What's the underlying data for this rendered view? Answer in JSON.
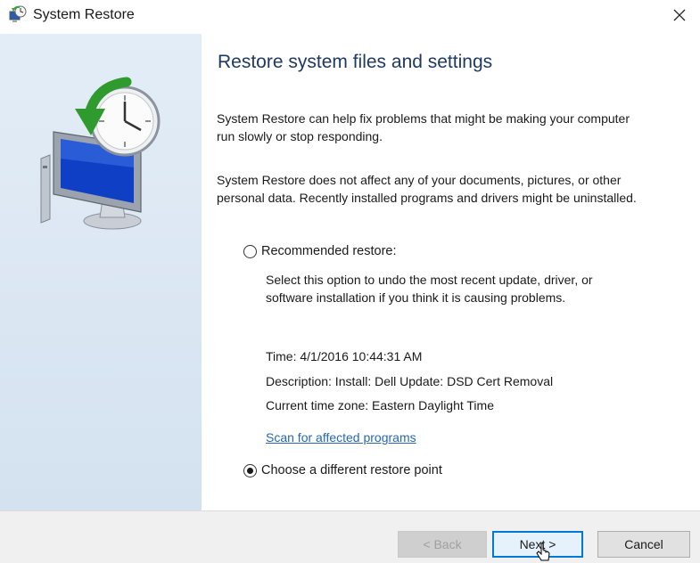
{
  "window": {
    "title": "System Restore",
    "close_icon": "close-icon",
    "app_icon": "system-restore-icon"
  },
  "sidebar": {
    "illustration": "computer-clock-restore-icon"
  },
  "content": {
    "heading": "Restore system files and settings",
    "paragraph1": "System Restore can help fix problems that might be making your computer run slowly or stop responding.",
    "paragraph2": "System Restore does not affect any of your documents, pictures, or other personal data. Recently installed programs and drivers might be uninstalled.",
    "options": {
      "recommended": {
        "label": "Recommended restore:",
        "checked": false,
        "description": "Select this option to undo the most recent update, driver, or software installation if you think it is causing problems."
      },
      "different": {
        "label": "Choose a different restore point",
        "checked": true
      }
    },
    "details": {
      "time": "Time: 4/1/2016 10:44:31 AM",
      "description": "Description: Install: Dell Update: DSD Cert Removal",
      "timezone": "Current time zone: Eastern Daylight Time"
    },
    "scan_link": "Scan for affected programs"
  },
  "footer": {
    "back_label": "< Back",
    "next_label": "Next >",
    "cancel_label": "Cancel"
  },
  "colors": {
    "heading": "#1e3a63",
    "link": "#2867b2",
    "sidebar": "#dae6f2",
    "focus": "#0078d7"
  }
}
